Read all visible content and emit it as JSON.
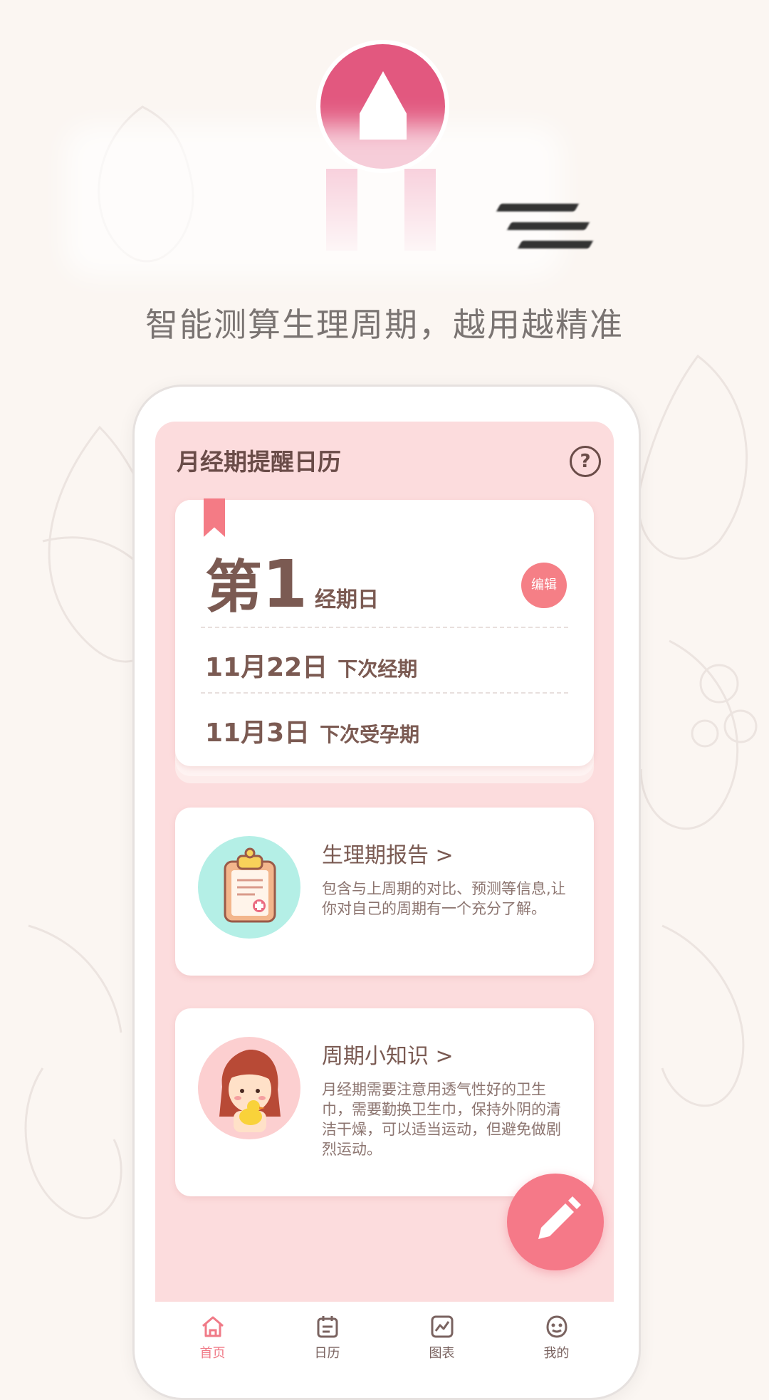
{
  "promo": {
    "slogan": "智能测算生理周期，越用越精准"
  },
  "app": {
    "title": "月经期提醒日历",
    "help_icon": "question-circle-icon"
  },
  "period_card": {
    "day_prefix": "第",
    "day_number": "1",
    "day_unit": "经期日",
    "edit_label": "编辑",
    "next_period_date": "11月22日",
    "next_period_label": "下次经期",
    "next_fertile_date": "11月3日",
    "next_fertile_label": "下次受孕期"
  },
  "report_card": {
    "title": "生理期报告 >",
    "body": "包含与上周期的对比、预测等信息,让你对自己的周期有一个充分了解。",
    "icon": "clipboard-icon"
  },
  "tips_card": {
    "title": "周期小知识 >",
    "body": "月经期需要注意用透气性好的卫生巾，需要勤换卫生巾，保持外阴的清洁干燥，可以适当运动，但避免做剧烈运动。",
    "icon": "girl-with-duck-icon"
  },
  "fab": {
    "icon": "pencil-icon"
  },
  "nav": [
    {
      "label": "首页",
      "icon": "home-icon",
      "active": true
    },
    {
      "label": "日历",
      "icon": "calendar-icon",
      "active": false
    },
    {
      "label": "图表",
      "icon": "chart-icon",
      "active": false
    },
    {
      "label": "我的",
      "icon": "smiley-icon",
      "active": false
    }
  ],
  "colors": {
    "accent": "#f57988",
    "screen_bg": "#fcdcdd",
    "text_brown": "#7b5a52",
    "logo_pink": "#e2587f"
  }
}
